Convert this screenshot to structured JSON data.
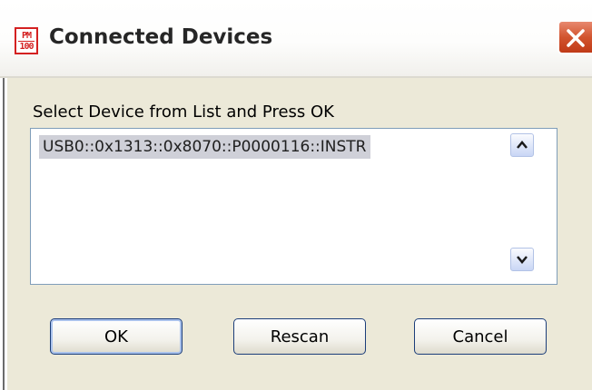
{
  "window": {
    "title": "Connected Devices",
    "icon": {
      "top_text": "PM",
      "bottom_text": "100",
      "color": "#d42121"
    },
    "close_icon": "close-x-icon"
  },
  "prompt": "Select Device from List and Press OK",
  "device_list": {
    "items": [
      "USB0::0x1313::0x8070::P0000116::INSTR"
    ],
    "selected_index": 0
  },
  "scrollbar": {
    "up_icon": "chevron-up-icon",
    "down_icon": "chevron-down-icon"
  },
  "buttons": {
    "ok": "OK",
    "rescan": "Rescan",
    "cancel": "Cancel"
  }
}
